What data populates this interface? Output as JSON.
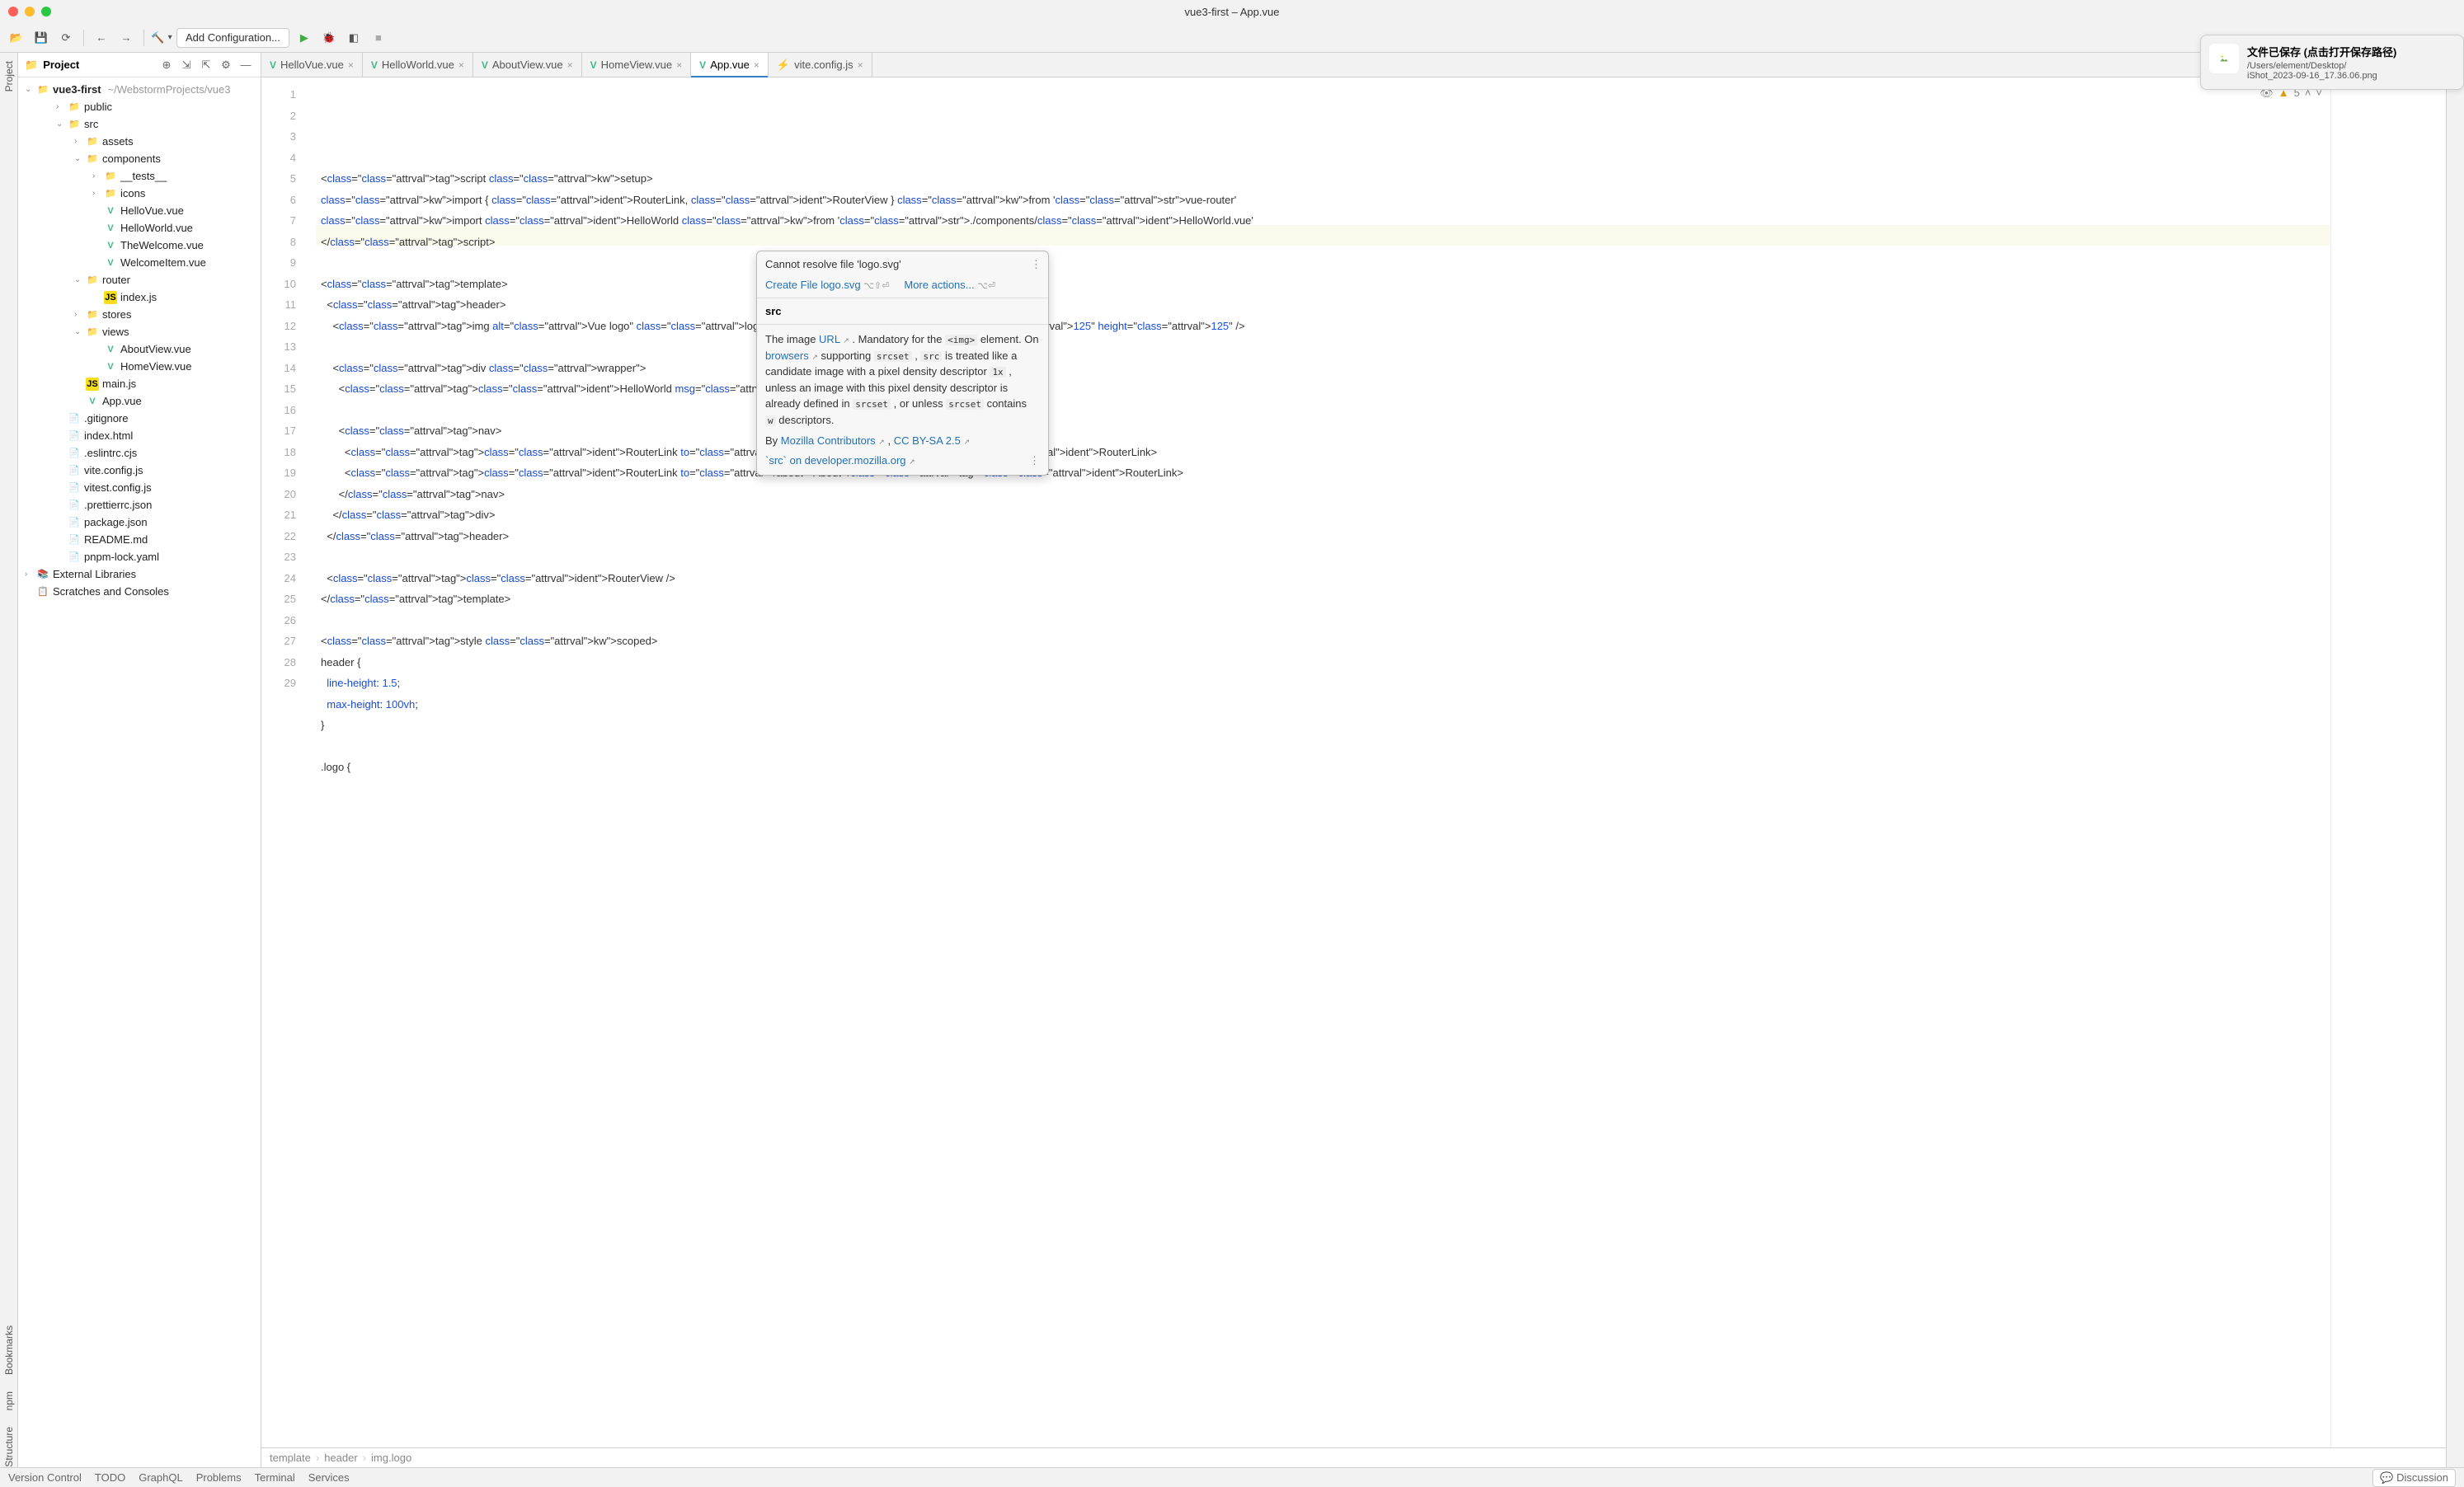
{
  "window": {
    "title": "vue3-first – App.vue"
  },
  "toolbar": {
    "config_label": "Add Configuration..."
  },
  "sidebar": {
    "title": "Project",
    "root": "vue3-first",
    "root_path": "~/WebstormProjects/vue3",
    "items": [
      {
        "label": "public",
        "kind": "folder",
        "indent": 46,
        "arrow": "›"
      },
      {
        "label": "src",
        "kind": "folder",
        "indent": 46,
        "arrow": "⌄"
      },
      {
        "label": "assets",
        "kind": "folder",
        "indent": 68,
        "arrow": "›"
      },
      {
        "label": "components",
        "kind": "folder",
        "indent": 68,
        "arrow": "⌄"
      },
      {
        "label": "__tests__",
        "kind": "folder",
        "indent": 90,
        "arrow": "›"
      },
      {
        "label": "icons",
        "kind": "folder",
        "indent": 90,
        "arrow": "›"
      },
      {
        "label": "HelloVue.vue",
        "kind": "vue",
        "indent": 90
      },
      {
        "label": "HelloWorld.vue",
        "kind": "vue",
        "indent": 90
      },
      {
        "label": "TheWelcome.vue",
        "kind": "vue",
        "indent": 90
      },
      {
        "label": "WelcomeItem.vue",
        "kind": "vue",
        "indent": 90
      },
      {
        "label": "router",
        "kind": "folder",
        "indent": 68,
        "arrow": "⌄"
      },
      {
        "label": "index.js",
        "kind": "js",
        "indent": 90
      },
      {
        "label": "stores",
        "kind": "folder",
        "indent": 68,
        "arrow": "›"
      },
      {
        "label": "views",
        "kind": "folder",
        "indent": 68,
        "arrow": "⌄"
      },
      {
        "label": "AboutView.vue",
        "kind": "vue",
        "indent": 90
      },
      {
        "label": "HomeView.vue",
        "kind": "vue",
        "indent": 90
      },
      {
        "label": "main.js",
        "kind": "js",
        "indent": 68
      },
      {
        "label": "App.vue",
        "kind": "vue",
        "indent": 68
      },
      {
        "label": ".gitignore",
        "kind": "file",
        "indent": 46
      },
      {
        "label": "index.html",
        "kind": "file",
        "indent": 46
      },
      {
        "label": ".eslintrc.cjs",
        "kind": "file",
        "indent": 46
      },
      {
        "label": "vite.config.js",
        "kind": "file",
        "indent": 46
      },
      {
        "label": "vitest.config.js",
        "kind": "file",
        "indent": 46
      },
      {
        "label": ".prettierrc.json",
        "kind": "file",
        "indent": 46
      },
      {
        "label": "package.json",
        "kind": "file",
        "indent": 46
      },
      {
        "label": "README.md",
        "kind": "file",
        "indent": 46
      },
      {
        "label": "pnpm-lock.yaml",
        "kind": "file",
        "indent": 46
      }
    ],
    "external": "External Libraries",
    "scratches": "Scratches and Consoles"
  },
  "tabs": [
    {
      "label": "HelloVue.vue",
      "icon": "vue"
    },
    {
      "label": "HelloWorld.vue",
      "icon": "vue"
    },
    {
      "label": "AboutView.vue",
      "icon": "vue"
    },
    {
      "label": "HomeView.vue",
      "icon": "vue"
    },
    {
      "label": "App.vue",
      "icon": "vue",
      "active": true
    },
    {
      "label": "vite.config.js",
      "icon": "vite"
    }
  ],
  "inspection": {
    "warnings": "5"
  },
  "code_lines": [
    "<script setup>",
    "import { RouterLink, RouterView } from 'vue-router'",
    "import HelloWorld from './components/HelloWorld.vue'",
    "</script>",
    "",
    "<template>",
    "  <header>",
    "    <img alt=\"Vue logo\" class=\"logo\" src=\"@/assets/logo.svg\" width=\"125\" height=\"125\" />",
    "",
    "    <div class=\"wrapper\">",
    "      <HelloWorld msg=\"You did it!\" />",
    "",
    "      <nav>",
    "        <RouterLink to=\"/\">Home</RouterLink>",
    "        <RouterLink to=\"/about\">About</RouterLink>",
    "      </nav>",
    "    </div>",
    "  </header>",
    "",
    "  <RouterView />",
    "</template>",
    "",
    "<style scoped>",
    "header {",
    "  line-height: 1.5;",
    "  max-height: 100vh;",
    "}",
    "",
    ".logo {"
  ],
  "popup": {
    "title": "Cannot resolve file 'logo.svg'",
    "action1": "Create File logo.svg",
    "shortcut1": "⌥⇧⏎",
    "action2": "More actions...",
    "shortcut2": "⌥⏎",
    "section_label": "src",
    "doc_prefix": "The image ",
    "doc_link_url": "URL",
    "doc_mid1": " . Mandatory for the ",
    "doc_code_img": "<img>",
    "doc_mid1b": " element. On ",
    "doc_link_browsers": "browsers",
    "doc_mid2": " supporting ",
    "doc_code_srcset": "srcset",
    "doc_mid2b": " , ",
    "doc_code_src": "src",
    "doc_mid3": " is treated like a candidate image with a pixel density descriptor ",
    "doc_code_1x": "1x",
    "doc_mid3b": " , unless an image with this pixel density descriptor is already defined in ",
    "doc_mid4": " , or unless ",
    "doc_mid5": " contains ",
    "doc_code_w": "w",
    "doc_mid6": " descriptors.",
    "by": "By ",
    "contributors": "Mozilla Contributors",
    "license_sep": " , ",
    "license": "CC BY-SA 2.5",
    "mdn": "`src` on developer.mozilla.org"
  },
  "notification": {
    "title": "文件已保存 (点击打开保存路径)",
    "line1": "/Users/element/Desktop/",
    "line2": "iShot_2023-09-16_17.36.06.png"
  },
  "breadcrumb": [
    "template",
    "header",
    "img.logo"
  ],
  "statusbar": {
    "items": [
      "Version Control",
      "TODO",
      "GraphQL",
      "Problems",
      "Terminal",
      "Services"
    ],
    "discussion": "Discussion"
  },
  "left_tools": [
    "Project",
    "Bookmarks",
    "npm",
    "Structure"
  ]
}
